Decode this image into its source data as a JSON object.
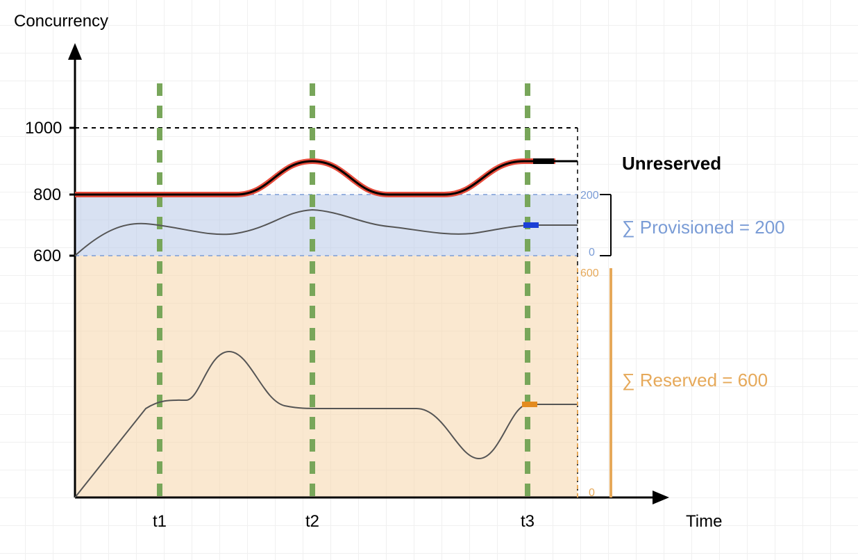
{
  "chart_data": {
    "type": "line",
    "title": "",
    "xlabel": "Time",
    "ylabel": "Concurrency",
    "ylim": [
      0,
      1000
    ],
    "y_ticks": [
      600,
      800,
      1000
    ],
    "x_categories": [
      "t1",
      "t2",
      "t3"
    ],
    "bands": [
      {
        "name": "Reserved",
        "from": 0,
        "to": 600,
        "color": "#f7d9b0",
        "label": "∑ Reserved = 600"
      },
      {
        "name": "Provisioned",
        "from": 600,
        "to": 800,
        "color": "#b8c9e8",
        "label": "∑ Provisioned = 200"
      },
      {
        "name": "Unreserved",
        "from": 800,
        "to": 1000,
        "color": "none",
        "label": "Unreserved"
      }
    ],
    "right_scale_provisioned": {
      "min": 0,
      "max": 200,
      "ticks": [
        0,
        200
      ]
    },
    "right_scale_reserved": {
      "min": 0,
      "max": 600,
      "ticks": [
        0,
        600
      ]
    },
    "series": [
      {
        "name": "Unreserved boundary (red/black)",
        "approx_points": [
          {
            "x": 0.0,
            "y": 800
          },
          {
            "x": 0.3,
            "y": 800
          },
          {
            "x": 0.45,
            "y": 900
          },
          {
            "x": 0.6,
            "y": 800
          },
          {
            "x": 0.75,
            "y": 800
          },
          {
            "x": 0.88,
            "y": 900
          },
          {
            "x": 1.0,
            "y": 900
          }
        ],
        "values_at_t": {
          "t1": 800,
          "t2": 900,
          "t3": 900
        }
      },
      {
        "name": "Provisioned usage (middle curve, local scale 0–200)",
        "approx_points": [
          {
            "x": 0.0,
            "y": 0
          },
          {
            "x": 0.12,
            "y": 100
          },
          {
            "x": 0.3,
            "y": 70
          },
          {
            "x": 0.45,
            "y": 150
          },
          {
            "x": 0.6,
            "y": 100
          },
          {
            "x": 0.75,
            "y": 70
          },
          {
            "x": 0.88,
            "y": 100
          },
          {
            "x": 1.0,
            "y": 100
          }
        ],
        "values_at_t": {
          "t1": 95,
          "t2": 150,
          "t3": 100
        }
      },
      {
        "name": "Reserved usage (bottom curve, local scale 0–600)",
        "approx_points": [
          {
            "x": 0.0,
            "y": 0
          },
          {
            "x": 0.12,
            "y": 200
          },
          {
            "x": 0.22,
            "y": 200
          },
          {
            "x": 0.3,
            "y": 330
          },
          {
            "x": 0.4,
            "y": 200
          },
          {
            "x": 0.6,
            "y": 200
          },
          {
            "x": 0.72,
            "y": 100
          },
          {
            "x": 0.82,
            "y": 200
          },
          {
            "x": 0.88,
            "y": 210
          },
          {
            "x": 1.0,
            "y": 210
          }
        ],
        "values_at_t": {
          "t1": 200,
          "t2": 200,
          "t3": 210
        }
      }
    ],
    "legend": [
      "Unreserved",
      "∑ Provisioned = 200",
      "∑ Reserved = 600"
    ]
  },
  "labels": {
    "ylabel": "Concurrency",
    "xlabel": "Time",
    "unreserved": "Unreserved",
    "provisioned": "∑ Provisioned = 200",
    "reserved": "∑ Reserved = 600",
    "y1000": "1000",
    "y800": "800",
    "y600": "600",
    "t1": "t1",
    "t2": "t2",
    "t3": "t3",
    "p200": "200",
    "p0": "0",
    "r600": "600",
    "r0": "0"
  }
}
